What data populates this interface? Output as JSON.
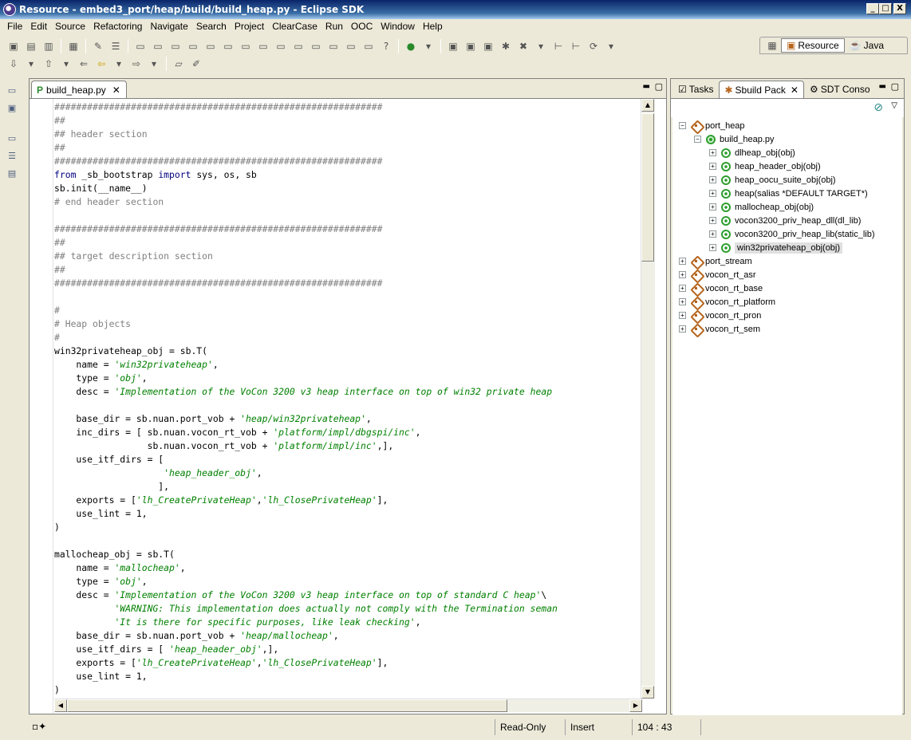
{
  "window": {
    "title": "Resource - embed3_port/heap/build/build_heap.py - Eclipse SDK",
    "minimize": "_",
    "maximize": "□",
    "close": "X"
  },
  "menubar": [
    "File",
    "Edit",
    "Source",
    "Refactoring",
    "Navigate",
    "Search",
    "Project",
    "ClearCase",
    "Run",
    "OOC",
    "Window",
    "Help"
  ],
  "perspectives": {
    "resource": "Resource",
    "java": "Java"
  },
  "editor": {
    "tab_label": "build_heap.py",
    "tab_close": "✕"
  },
  "code": {
    "lines": [
      [
        [
          "cm",
          "############################################################"
        ]
      ],
      [
        [
          "cm",
          "##"
        ]
      ],
      [
        [
          "cm",
          "## header section"
        ]
      ],
      [
        [
          "cm",
          "##"
        ]
      ],
      [
        [
          "cm",
          "############################################################"
        ]
      ],
      [
        [
          "kw",
          "from"
        ],
        [
          "tx",
          " _sb_bootstrap "
        ],
        [
          "kw",
          "import"
        ],
        [
          "tx",
          " sys, os, sb"
        ]
      ],
      [
        [
          "tx",
          "sb.init(__name__)"
        ]
      ],
      [
        [
          "cm",
          "# end header section"
        ]
      ],
      [
        [
          "tx",
          ""
        ]
      ],
      [
        [
          "cm",
          "############################################################"
        ]
      ],
      [
        [
          "cm",
          "##"
        ]
      ],
      [
        [
          "cm",
          "## target description section"
        ]
      ],
      [
        [
          "cm",
          "##"
        ]
      ],
      [
        [
          "cm",
          "############################################################"
        ]
      ],
      [
        [
          "tx",
          ""
        ]
      ],
      [
        [
          "cm",
          "#"
        ]
      ],
      [
        [
          "cm",
          "# Heap objects"
        ]
      ],
      [
        [
          "cm",
          "#"
        ]
      ],
      [
        [
          "tx",
          "win32privateheap_obj = sb.T("
        ]
      ],
      [
        [
          "tx",
          "    name = "
        ],
        [
          "st",
          "'win32privateheap'"
        ],
        [
          "tx",
          ","
        ]
      ],
      [
        [
          "tx",
          "    type = "
        ],
        [
          "st",
          "'obj'"
        ],
        [
          "tx",
          ","
        ]
      ],
      [
        [
          "tx",
          "    desc = "
        ],
        [
          "st",
          "'Implementation of the VoCon 3200 v3 heap interface on top of win32 private heap"
        ]
      ],
      [
        [
          "tx",
          ""
        ]
      ],
      [
        [
          "tx",
          "    base_dir = sb.nuan.port_vob + "
        ],
        [
          "st",
          "'heap/win32privateheap'"
        ],
        [
          "tx",
          ","
        ]
      ],
      [
        [
          "tx",
          "    inc_dirs = [ sb.nuan.vocon_rt_vob + "
        ],
        [
          "st",
          "'platform/impl/dbgspi/inc'"
        ],
        [
          "tx",
          ","
        ]
      ],
      [
        [
          "tx",
          "                 sb.nuan.vocon_rt_vob + "
        ],
        [
          "st",
          "'platform/impl/inc'"
        ],
        [
          "tx",
          ",],"
        ]
      ],
      [
        [
          "tx",
          "    use_itf_dirs = ["
        ]
      ],
      [
        [
          "tx",
          "                    "
        ],
        [
          "st",
          "'heap_header_obj'"
        ],
        [
          "tx",
          ","
        ]
      ],
      [
        [
          "tx",
          "                   ],"
        ]
      ],
      [
        [
          "tx",
          "    exports = ["
        ],
        [
          "st",
          "'lh_CreatePrivateHeap'"
        ],
        [
          "tx",
          ","
        ],
        [
          "st",
          "'lh_ClosePrivateHeap'"
        ],
        [
          "tx",
          "],"
        ]
      ],
      [
        [
          "tx",
          "    use_lint = 1,"
        ]
      ],
      [
        [
          "tx",
          ")"
        ]
      ],
      [
        [
          "tx",
          ""
        ]
      ],
      [
        [
          "tx",
          "mallocheap_obj = sb.T("
        ]
      ],
      [
        [
          "tx",
          "    name = "
        ],
        [
          "st",
          "'mallocheap'"
        ],
        [
          "tx",
          ","
        ]
      ],
      [
        [
          "tx",
          "    type = "
        ],
        [
          "st",
          "'obj'"
        ],
        [
          "tx",
          ","
        ]
      ],
      [
        [
          "tx",
          "    desc = "
        ],
        [
          "st",
          "'Implementation of the VoCon 3200 v3 heap interface on top of standard C heap'"
        ],
        [
          "tx",
          "\\"
        ]
      ],
      [
        [
          "tx",
          "           "
        ],
        [
          "st",
          "'WARNING: This implementation does actually not comply with the Termination seman"
        ]
      ],
      [
        [
          "tx",
          "           "
        ],
        [
          "st",
          "'It is there for specific purposes, like leak checking'"
        ],
        [
          "tx",
          ","
        ]
      ],
      [
        [
          "tx",
          "    base_dir = sb.nuan.port_vob + "
        ],
        [
          "st",
          "'heap/mallocheap'"
        ],
        [
          "tx",
          ","
        ]
      ],
      [
        [
          "tx",
          "    use_itf_dirs = [ "
        ],
        [
          "st",
          "'heap_header_obj'"
        ],
        [
          "tx",
          ",],"
        ]
      ],
      [
        [
          "tx",
          "    exports = ["
        ],
        [
          "st",
          "'lh_CreatePrivateHeap'"
        ],
        [
          "tx",
          ","
        ],
        [
          "st",
          "'lh_ClosePrivateHeap'"
        ],
        [
          "tx",
          "],"
        ]
      ],
      [
        [
          "tx",
          "    use_lint = 1,"
        ]
      ],
      [
        [
          "tx",
          ")"
        ]
      ]
    ]
  },
  "right_panel": {
    "tabs": {
      "tasks": "Tasks",
      "sbuild": "Sbuild Pack",
      "sdt": "SDT Conso",
      "close": "✕"
    },
    "tree": [
      {
        "label": "port_heap",
        "level": 0,
        "kind": "package",
        "expander": "−"
      },
      {
        "label": "build_heap.py",
        "level": 1,
        "kind": "file",
        "expander": "−"
      },
      {
        "label": "dlheap_obj(obj)",
        "level": 2,
        "kind": "target",
        "expander": "+"
      },
      {
        "label": "heap_header_obj(obj)",
        "level": 2,
        "kind": "target",
        "expander": "+"
      },
      {
        "label": "heap_oocu_suite_obj(obj)",
        "level": 2,
        "kind": "target",
        "expander": "+"
      },
      {
        "label": "heap(salias *DEFAULT TARGET*)",
        "level": 2,
        "kind": "target",
        "expander": "+"
      },
      {
        "label": "mallocheap_obj(obj)",
        "level": 2,
        "kind": "target",
        "expander": "+"
      },
      {
        "label": "vocon3200_priv_heap_dll(dl_lib)",
        "level": 2,
        "kind": "target",
        "expander": "+"
      },
      {
        "label": "vocon3200_priv_heap_lib(static_lib)",
        "level": 2,
        "kind": "target",
        "expander": "+"
      },
      {
        "label": "win32privateheap_obj(obj)",
        "level": 2,
        "kind": "target",
        "expander": "+",
        "selected": true
      },
      {
        "label": "port_stream",
        "level": 0,
        "kind": "package",
        "expander": "+"
      },
      {
        "label": "vocon_rt_asr",
        "level": 0,
        "kind": "package",
        "expander": "+"
      },
      {
        "label": "vocon_rt_base",
        "level": 0,
        "kind": "package",
        "expander": "+"
      },
      {
        "label": "vocon_rt_platform",
        "level": 0,
        "kind": "package",
        "expander": "+"
      },
      {
        "label": "vocon_rt_pron",
        "level": 0,
        "kind": "package",
        "expander": "+"
      },
      {
        "label": "vocon_rt_sem",
        "level": 0,
        "kind": "package",
        "expander": "+"
      }
    ]
  },
  "status": {
    "mode": "Read-Only",
    "insert": "Insert",
    "position": "104 : 43"
  },
  "colors": {
    "comment": "#808080",
    "keyword": "#00007F",
    "string": "#008000",
    "titlebar": "#0A246A"
  }
}
